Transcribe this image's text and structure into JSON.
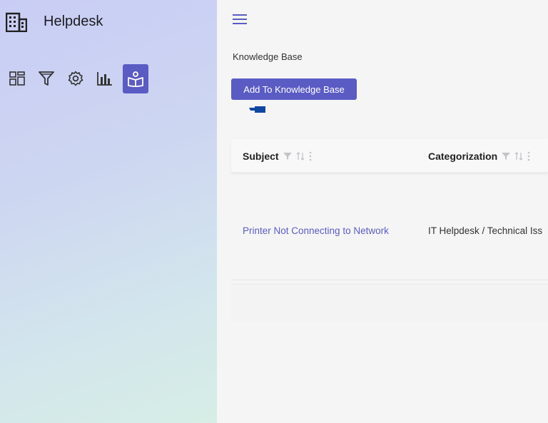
{
  "app": {
    "title": "Helpdesk"
  },
  "sidebar": {
    "icons": [
      {
        "name": "dashboard-icon",
        "active": false
      },
      {
        "name": "filter-icon",
        "active": false
      },
      {
        "name": "gear-icon",
        "active": false
      },
      {
        "name": "bar-chart-icon",
        "active": false
      },
      {
        "name": "knowledge-base-icon",
        "active": true
      }
    ]
  },
  "main": {
    "page_title": "Knowledge Base",
    "add_button_label": "Add To Knowledge Base",
    "table": {
      "columns": [
        {
          "label": "Subject"
        },
        {
          "label": "Categorization"
        }
      ],
      "rows": [
        {
          "subject": "Printer Not Connecting to Network",
          "categorization": "IT Helpdesk / Technical Iss"
        }
      ]
    }
  },
  "colors": {
    "accent": "#5b5bc4",
    "sidebar_top": "#c9cdf5",
    "sidebar_bottom": "#d6eee6"
  }
}
